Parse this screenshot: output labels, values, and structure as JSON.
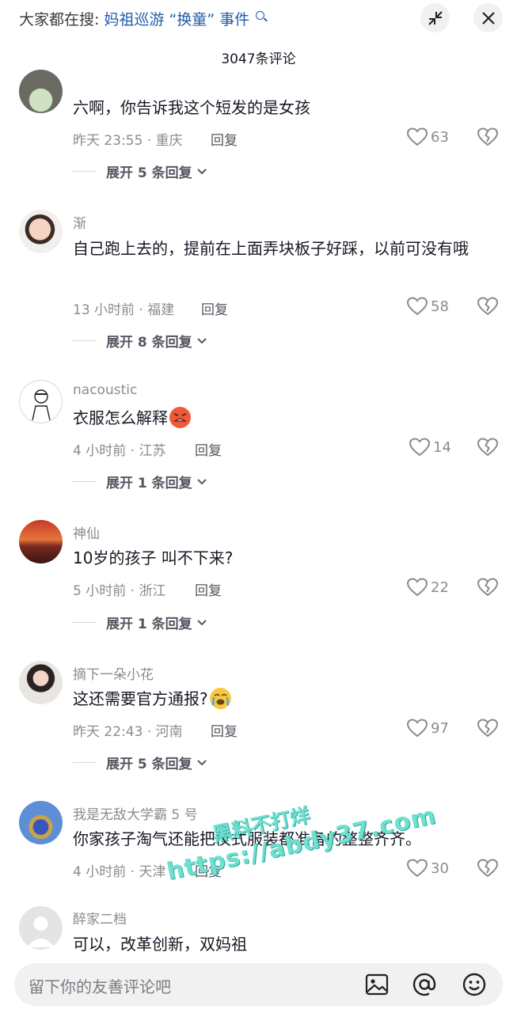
{
  "header": {
    "search_prefix": "大家都在搜:",
    "search_query": "妈祖巡游 “换童” 事件",
    "comment_count": "3047条评论"
  },
  "comments": [
    {
      "username": "",
      "content": "六啊，你告诉我这个短发的是女孩",
      "time": "昨天 23:55",
      "location": "· 重庆",
      "reply": "回复",
      "likes": "63",
      "expand": "展开 5 条回复"
    },
    {
      "username": "渐",
      "content": "自己跑上去的，提前在上面弄块板子好踩，以前可没有哦",
      "time": "13 小时前",
      "location": "· 福建",
      "reply": "回复",
      "likes": "58",
      "expand": "展开 8 条回复"
    },
    {
      "username": "nacoustic",
      "content": "衣服怎么解释",
      "time": "4 小时前",
      "location": "· 江苏",
      "reply": "回复",
      "likes": "14",
      "expand": "展开 1 条回复"
    },
    {
      "username": "神仙",
      "content": "10岁的孩子  叫不下来?",
      "time": "5 小时前",
      "location": "· 浙江",
      "reply": "回复",
      "likes": "22",
      "expand": "展开 1 条回复"
    },
    {
      "username": "摘下一朵小花",
      "content": "这还需要官方通报?",
      "time": "昨天 22:43",
      "location": "· 河南",
      "reply": "回复",
      "likes": "97",
      "expand": "展开 5 条回复"
    },
    {
      "username": "我是无敌大学霸 5 号",
      "content": "你家孩子淘气还能把仪式服装都准备的整整齐齐。",
      "time": "4 小时前",
      "location": "· 天津",
      "reply": "回复",
      "likes": "30",
      "expand": ""
    },
    {
      "username": "醉家二档",
      "content": "可以，改革创新，双妈祖",
      "time": "",
      "location": "",
      "reply": "",
      "likes": "",
      "expand": ""
    }
  ],
  "input": {
    "placeholder": "留下你的友善评论吧"
  },
  "watermark": {
    "line1": "黑料不打烊",
    "line2": "https://abdy37.com"
  },
  "colors": {
    "query_blue": "#1f5da8",
    "muted_gray": "#8a8b91",
    "text_dark": "#161823",
    "watermark_teal": "#6fe0d0"
  },
  "icons": [
    "search-icon",
    "minimize-icon",
    "close-icon",
    "heart-icon",
    "dislike-heart-icon",
    "chevron-down-icon",
    "image-icon",
    "at-icon",
    "emoji-icon"
  ]
}
